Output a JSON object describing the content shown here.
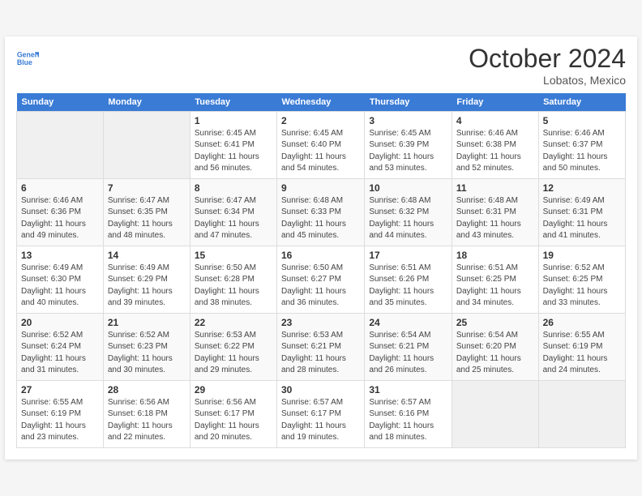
{
  "header": {
    "logo_line1": "General",
    "logo_line2": "Blue",
    "month": "October 2024",
    "location": "Lobatos, Mexico"
  },
  "weekdays": [
    "Sunday",
    "Monday",
    "Tuesday",
    "Wednesday",
    "Thursday",
    "Friday",
    "Saturday"
  ],
  "weeks": [
    [
      {
        "day": null
      },
      {
        "day": null
      },
      {
        "day": "1",
        "sunrise": "6:45 AM",
        "sunset": "6:41 PM",
        "daylight": "11 hours and 56 minutes."
      },
      {
        "day": "2",
        "sunrise": "6:45 AM",
        "sunset": "6:40 PM",
        "daylight": "11 hours and 54 minutes."
      },
      {
        "day": "3",
        "sunrise": "6:45 AM",
        "sunset": "6:39 PM",
        "daylight": "11 hours and 53 minutes."
      },
      {
        "day": "4",
        "sunrise": "6:46 AM",
        "sunset": "6:38 PM",
        "daylight": "11 hours and 52 minutes."
      },
      {
        "day": "5",
        "sunrise": "6:46 AM",
        "sunset": "6:37 PM",
        "daylight": "11 hours and 50 minutes."
      }
    ],
    [
      {
        "day": "6",
        "sunrise": "6:46 AM",
        "sunset": "6:36 PM",
        "daylight": "11 hours and 49 minutes."
      },
      {
        "day": "7",
        "sunrise": "6:47 AM",
        "sunset": "6:35 PM",
        "daylight": "11 hours and 48 minutes."
      },
      {
        "day": "8",
        "sunrise": "6:47 AM",
        "sunset": "6:34 PM",
        "daylight": "11 hours and 47 minutes."
      },
      {
        "day": "9",
        "sunrise": "6:48 AM",
        "sunset": "6:33 PM",
        "daylight": "11 hours and 45 minutes."
      },
      {
        "day": "10",
        "sunrise": "6:48 AM",
        "sunset": "6:32 PM",
        "daylight": "11 hours and 44 minutes."
      },
      {
        "day": "11",
        "sunrise": "6:48 AM",
        "sunset": "6:31 PM",
        "daylight": "11 hours and 43 minutes."
      },
      {
        "day": "12",
        "sunrise": "6:49 AM",
        "sunset": "6:31 PM",
        "daylight": "11 hours and 41 minutes."
      }
    ],
    [
      {
        "day": "13",
        "sunrise": "6:49 AM",
        "sunset": "6:30 PM",
        "daylight": "11 hours and 40 minutes."
      },
      {
        "day": "14",
        "sunrise": "6:49 AM",
        "sunset": "6:29 PM",
        "daylight": "11 hours and 39 minutes."
      },
      {
        "day": "15",
        "sunrise": "6:50 AM",
        "sunset": "6:28 PM",
        "daylight": "11 hours and 38 minutes."
      },
      {
        "day": "16",
        "sunrise": "6:50 AM",
        "sunset": "6:27 PM",
        "daylight": "11 hours and 36 minutes."
      },
      {
        "day": "17",
        "sunrise": "6:51 AM",
        "sunset": "6:26 PM",
        "daylight": "11 hours and 35 minutes."
      },
      {
        "day": "18",
        "sunrise": "6:51 AM",
        "sunset": "6:25 PM",
        "daylight": "11 hours and 34 minutes."
      },
      {
        "day": "19",
        "sunrise": "6:52 AM",
        "sunset": "6:25 PM",
        "daylight": "11 hours and 33 minutes."
      }
    ],
    [
      {
        "day": "20",
        "sunrise": "6:52 AM",
        "sunset": "6:24 PM",
        "daylight": "11 hours and 31 minutes."
      },
      {
        "day": "21",
        "sunrise": "6:52 AM",
        "sunset": "6:23 PM",
        "daylight": "11 hours and 30 minutes."
      },
      {
        "day": "22",
        "sunrise": "6:53 AM",
        "sunset": "6:22 PM",
        "daylight": "11 hours and 29 minutes."
      },
      {
        "day": "23",
        "sunrise": "6:53 AM",
        "sunset": "6:21 PM",
        "daylight": "11 hours and 28 minutes."
      },
      {
        "day": "24",
        "sunrise": "6:54 AM",
        "sunset": "6:21 PM",
        "daylight": "11 hours and 26 minutes."
      },
      {
        "day": "25",
        "sunrise": "6:54 AM",
        "sunset": "6:20 PM",
        "daylight": "11 hours and 25 minutes."
      },
      {
        "day": "26",
        "sunrise": "6:55 AM",
        "sunset": "6:19 PM",
        "daylight": "11 hours and 24 minutes."
      }
    ],
    [
      {
        "day": "27",
        "sunrise": "6:55 AM",
        "sunset": "6:19 PM",
        "daylight": "11 hours and 23 minutes."
      },
      {
        "day": "28",
        "sunrise": "6:56 AM",
        "sunset": "6:18 PM",
        "daylight": "11 hours and 22 minutes."
      },
      {
        "day": "29",
        "sunrise": "6:56 AM",
        "sunset": "6:17 PM",
        "daylight": "11 hours and 20 minutes."
      },
      {
        "day": "30",
        "sunrise": "6:57 AM",
        "sunset": "6:17 PM",
        "daylight": "11 hours and 19 minutes."
      },
      {
        "day": "31",
        "sunrise": "6:57 AM",
        "sunset": "6:16 PM",
        "daylight": "11 hours and 18 minutes."
      },
      {
        "day": null
      },
      {
        "day": null
      }
    ]
  ]
}
